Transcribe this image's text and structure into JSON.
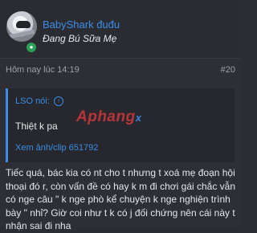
{
  "user": {
    "name": "BabyShark đuđu",
    "title": "Đang Bú Sữa Mẹ",
    "online_icon": "online-indicator-icon"
  },
  "post": {
    "timestamp": "Hôm nay lúc 14:19",
    "number": "#20",
    "quote": {
      "author": "LSO nói:",
      "author_icon": "arrow-up-circle-icon",
      "text": "Thiệt k pa",
      "expand_link": "Xem ảnh/clip 651792"
    },
    "content": "Tiếc quá, bác kia có nt cho t nhưng t xoá mẹ đoạn hội thoại đó r, còn vấn đề có hay k m đi chơi gái chắc vẫn có nge câu \" k nge phò kể chuyện k nge nghiện trình bày \" nhỉ? Giờ coi như t k có j đối chứng nên cái này t nhận sai đi nha"
  },
  "watermark": {
    "text": "Aphang",
    "suffix": "x"
  },
  "colors": {
    "accent": "#3c8ce7",
    "background": "#2d2f35",
    "quote_background": "#26282d",
    "online": "#2b9f58",
    "watermark": "#c5363a"
  }
}
